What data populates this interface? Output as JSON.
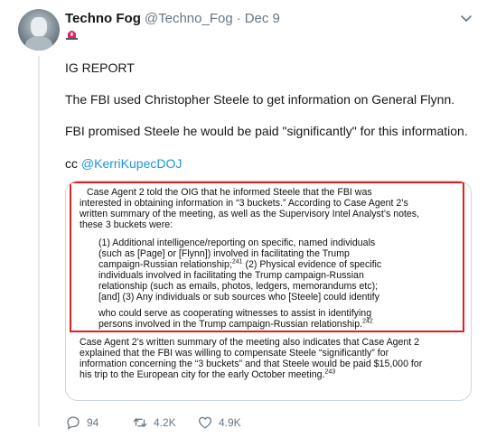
{
  "tweet": {
    "author_name": "Techno Fog",
    "author_handle": "@Techno_Fog",
    "separator": "·",
    "date": "Dec 9",
    "lines": [
      "IG REPORT",
      "The FBI used Christopher Steele to get information on General Flynn.",
      "FBI promised Steele he would be paid \"significantly\" for this information."
    ],
    "cc_prefix": "cc ",
    "cc_mention": "@KerriKupecDOJ"
  },
  "document": {
    "p1": [
      "Case Agent 2 told the OIG that he informed Steele that the FBI was",
      "interested in obtaining information in “3 buckets.”  According to Case Agent 2’s",
      "written summary of the meeting, as well as the Supervisory Intel Analyst’s notes,",
      "these 3 buckets were:"
    ],
    "p2": [
      "(1) Additional intelligence/reporting on specific, named individuals",
      "(such as [Page] or [Flynn]) involved in facilitating the Trump",
      "campaign-Russian relationship;",
      "(2) Physical evidence of specific",
      "individuals involved in facilitating the Trump campaign-Russian",
      "relationship (such as emails, photos, ledgers, memorandums etc);",
      "[and] (3) Any individuals or sub sources who [Steele] could identify"
    ],
    "p2_footnote": "241",
    "p3": [
      "who could serve as cooperating witnesses to assist in identifying",
      "persons involved in the Trump campaign-Russian relationship."
    ],
    "p3_footnote": "242",
    "p4": [
      "Case Agent 2’s written summary of the meeting also indicates that Case Agent 2",
      "explained that the FBI was willing to compensate Steele “significantly” for",
      "information concerning the “3 buckets” and that Steele would be paid $15,000 for",
      "his trip to the European city for the early October meeting."
    ],
    "p4_footnote": "243"
  },
  "actions": {
    "replies": "94",
    "retweets": "4.2K",
    "likes": "4.9K"
  },
  "colors": {
    "link": "#1b95e0",
    "muted": "#657786",
    "highlight_box": "#e02020"
  },
  "icons": [
    "avatar",
    "chevron-down-icon",
    "siren-icon",
    "reply-icon",
    "retweet-icon",
    "like-icon"
  ]
}
